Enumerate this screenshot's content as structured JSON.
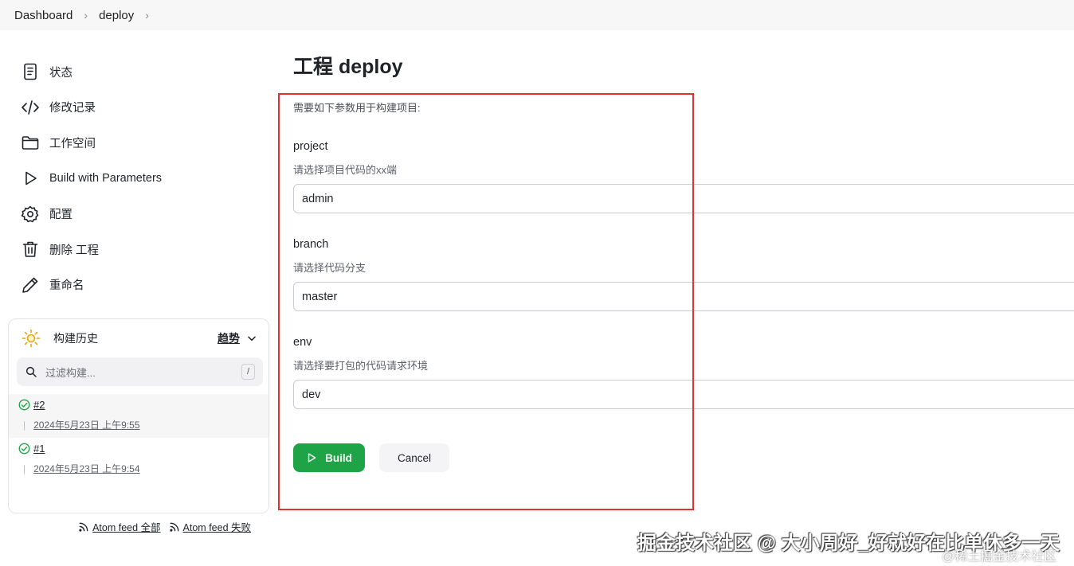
{
  "breadcrumb": {
    "items": [
      "Dashboard",
      "deploy"
    ]
  },
  "sidebar": {
    "items": [
      {
        "label": "状态",
        "icon": "document-icon"
      },
      {
        "label": "修改记录",
        "icon": "code-icon"
      },
      {
        "label": "工作空间",
        "icon": "folder-icon"
      },
      {
        "label": "Build with Parameters",
        "icon": "play-icon"
      },
      {
        "label": "配置",
        "icon": "gear-icon"
      },
      {
        "label": "删除 工程",
        "icon": "trash-icon"
      },
      {
        "label": "重命名",
        "icon": "pencil-icon"
      }
    ]
  },
  "history": {
    "title": "构建历史",
    "trend_label": "趋势",
    "filter_placeholder": "过滤构建...",
    "filter_shortcut": "/",
    "builds": [
      {
        "number": "#2",
        "date": "2024年5月23日 上午9:55",
        "status": "success"
      },
      {
        "number": "#1",
        "date": "2024年5月23日 上午9:54",
        "status": "success"
      }
    ],
    "feeds": [
      "Atom feed 全部",
      "Atom feed 失败"
    ]
  },
  "main": {
    "title": "工程 deploy",
    "intro": "需要如下参数用于构建项目:",
    "params": [
      {
        "name": "project",
        "description": "请选择项目代码的xx端",
        "value": "admin"
      },
      {
        "name": "branch",
        "description": "请选择代码分支",
        "value": "master"
      },
      {
        "name": "env",
        "description": "请选择要打包的代码请求环境",
        "value": "dev"
      }
    ],
    "build_label": "Build",
    "cancel_label": "Cancel"
  },
  "watermark": {
    "text": "掘金技术社区 @ 大小周好_好就好在比单休多一天",
    "small": "@稀土掘金技术社区"
  },
  "colors": {
    "primary": "#1ea446",
    "highlight_box": "#e03131"
  }
}
